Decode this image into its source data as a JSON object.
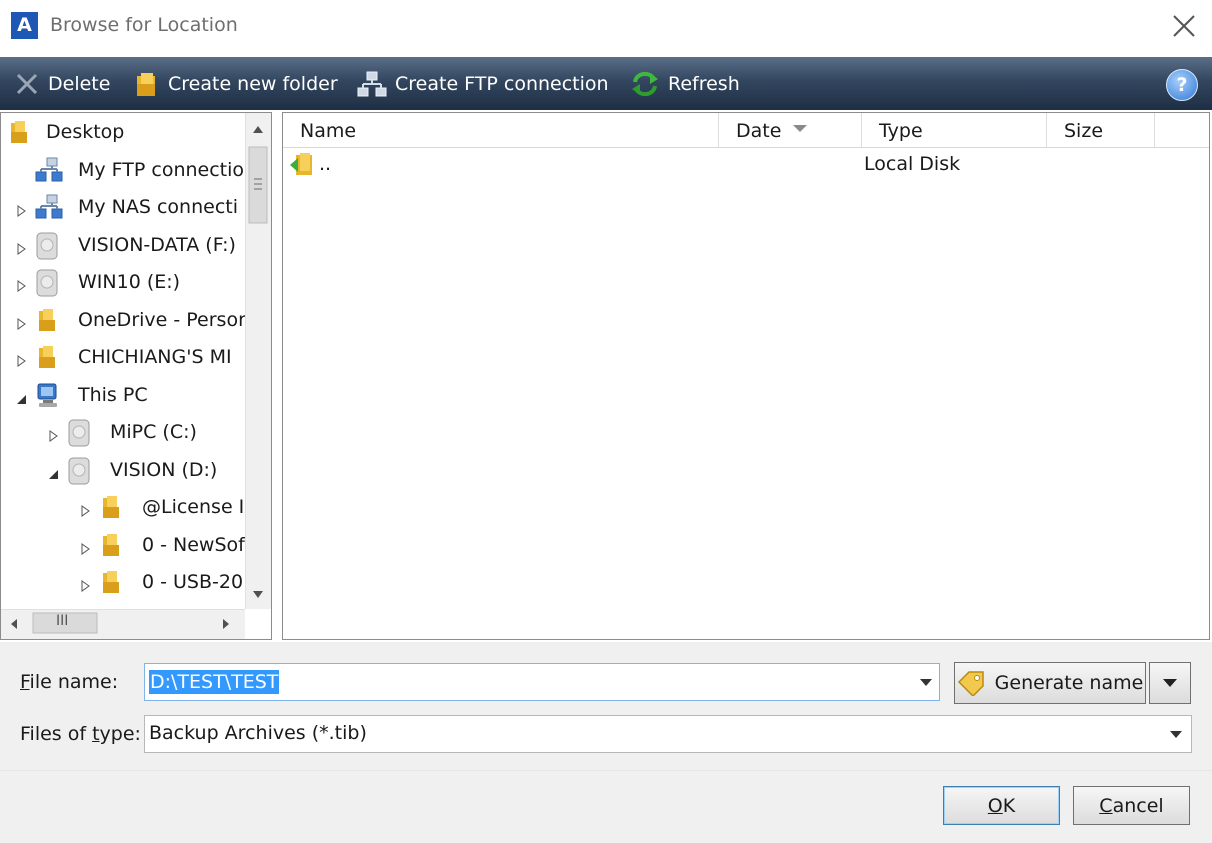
{
  "window": {
    "title": "Browse for Location",
    "logo_letter": "A"
  },
  "toolbar": {
    "delete_label": "Delete",
    "new_folder_label": "Create new folder",
    "ftp_label": "Create FTP connection",
    "refresh_label": "Refresh",
    "help_label": "?"
  },
  "tree": {
    "items": [
      {
        "label": "Desktop",
        "icon": "folder-icon",
        "expander": "none"
      },
      {
        "label": "My FTP connectio",
        "icon": "network-icon",
        "expander": "none"
      },
      {
        "label": "My NAS connecti",
        "icon": "network-icon",
        "expander": "collapsed"
      },
      {
        "label": "VISION-DATA (F:)",
        "icon": "drive-icon",
        "expander": "collapsed"
      },
      {
        "label": "WIN10 (E:)",
        "icon": "drive-icon",
        "expander": "collapsed"
      },
      {
        "label": "OneDrive - Persor",
        "icon": "folder-icon",
        "expander": "collapsed"
      },
      {
        "label": "CHICHIANG'S MI",
        "icon": "folder-icon",
        "expander": "collapsed"
      },
      {
        "label": "This PC",
        "icon": "computer-icon",
        "expander": "expanded"
      },
      {
        "label": "MiPC (C:)",
        "icon": "drive-icon",
        "expander": "collapsed"
      },
      {
        "label": "VISION (D:)",
        "icon": "drive-icon",
        "expander": "expanded"
      },
      {
        "label": "@License I",
        "icon": "folder-icon",
        "expander": "collapsed"
      },
      {
        "label": "0 - NewSof",
        "icon": "folder-icon",
        "expander": "collapsed"
      },
      {
        "label": "0 - USB-20",
        "icon": "folder-icon",
        "expander": "collapsed"
      }
    ],
    "hscroll_grip": "III"
  },
  "list": {
    "columns": [
      "Name",
      "Date",
      "Type",
      "Size"
    ],
    "rows": [
      {
        "name": "..",
        "date": "",
        "type": "Local Disk",
        "size": ""
      }
    ]
  },
  "form": {
    "filename_label_accel": "F",
    "filename_label_rest": "ile name:",
    "filename_value": "D:\\TEST\\TEST",
    "filetype_label_pre": "Files of ",
    "filetype_label_accel": "t",
    "filetype_label_rest": "ype:",
    "filetype_value": "Backup Archives (*.tib)",
    "generate_label": "Generate name"
  },
  "buttons": {
    "ok_accel": "O",
    "ok_rest": "K",
    "cancel_accel": "C",
    "cancel_rest": "ancel"
  },
  "colors": {
    "accent": "#3399ff",
    "toolbar": "#2c3e55",
    "logo": "#1f57b5"
  }
}
